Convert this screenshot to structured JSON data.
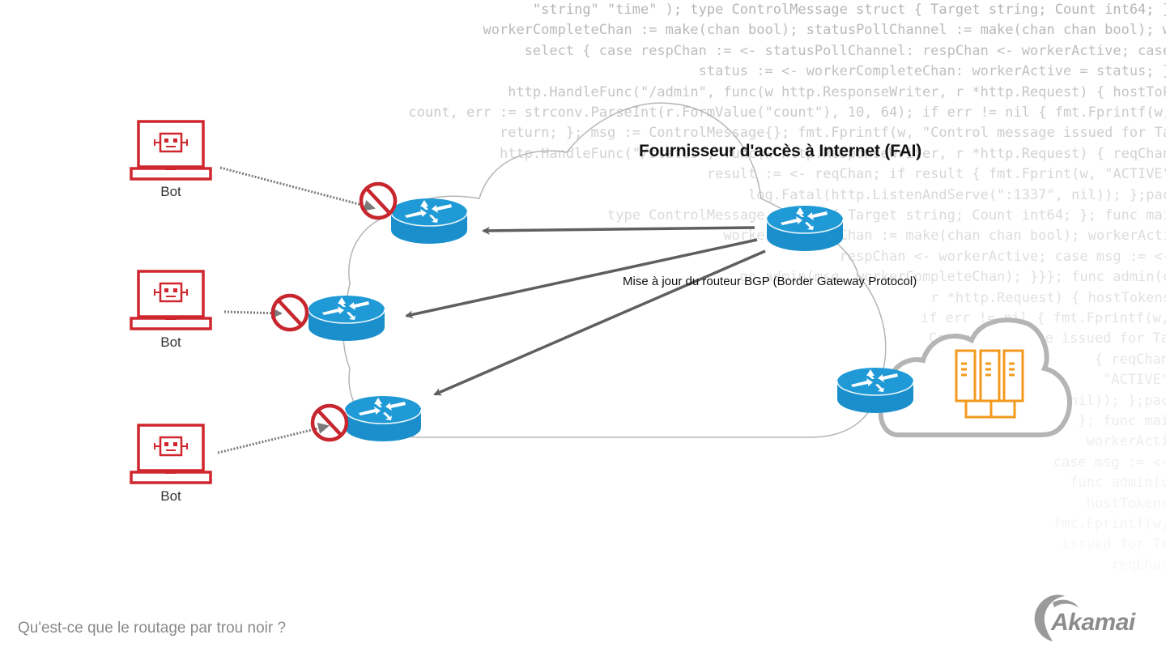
{
  "diagram": {
    "title": "Fournisseur d'accès à Internet (FAI)",
    "bgp_update_label": "Mise à jour du routeur BGP (Border Gateway Protocol)",
    "bots": [
      {
        "label": "Bot",
        "status": "blocked"
      },
      {
        "label": "Bot",
        "status": "blocked"
      },
      {
        "label": "Bot",
        "status": "blocked"
      }
    ],
    "nodes": {
      "isp_edge_routers": 3,
      "bgp_router": 1,
      "origin_router": 1,
      "origin_servers": 3
    },
    "icons": {
      "bot": "laptop-robot-icon",
      "router": "router-icon",
      "blocked": "prohibited-icon",
      "origin": "server-rack-icon",
      "cloud": "cloud-icon"
    },
    "colors": {
      "bot_red": "#d0262e",
      "router_blue": "#1f9ad6",
      "server_orange": "#f39a1e",
      "arrow_gray": "#5f5f5f",
      "cloud_outline": "#b5b5b5",
      "caption_gray": "#8a8a8a"
    }
  },
  "footer": {
    "caption": "Qu'est-ce que le routage par trou noir ?",
    "brand": "Akamai"
  },
  "background_code": [
    "\"string\" \"time\" ); type ControlMessage struct { Target string; Count int64; }",
    "workerCompleteChan := make(chan bool); statusPollChannel := make(chan chan bool); w",
    "select { case respChan := <- statusPollChannel: respChan <- workerActive; case",
    "status := <- workerCompleteChan: workerActive = status; }",
    "http.HandleFunc(\"/admin\", func(w http.ResponseWriter, r *http.Request) { hostTok",
    "count, err := strconv.ParseInt(r.FormValue(\"count\"), 10, 64); if err != nil { fmt.Fprintf(w,",
    "return; }; msg := ControlMessage{}; fmt.Fprintf(w, \"Control message issued for Ta",
    "http.HandleFunc(\"/status\", func(w http.ResponseWriter, r *http.Request) { reqChan",
    "result := <- reqChan; if result { fmt.Fprint(w, \"ACTIVE\"",
    "log.Fatal(http.ListenAndServe(\":1337\", nil)); };pac",
    "type ControlMessage struct { Target string; Count int64; }; func mai",
    "workerCompleteChan := make(chan chan bool); workerActi",
    "respChan <- workerActive; case msg := <-",
    "go admin(msg, workerCompleteChan); }}}; func admin(c",
    "r *http.Request) { hostTokens",
    "if err != nil { fmt.Fprintf(w,",
    "Control message issued for Ta",
    "{ reqChan",
    "\"ACTIVE\"",
    "nil)); };pac",
    "}; func mai",
    "workerActi",
    "case msg := <-",
    "func admin(c",
    "hostTokens",
    "fmt.Fprintf(w,",
    "issued for Ta",
    "reqChan"
  ]
}
